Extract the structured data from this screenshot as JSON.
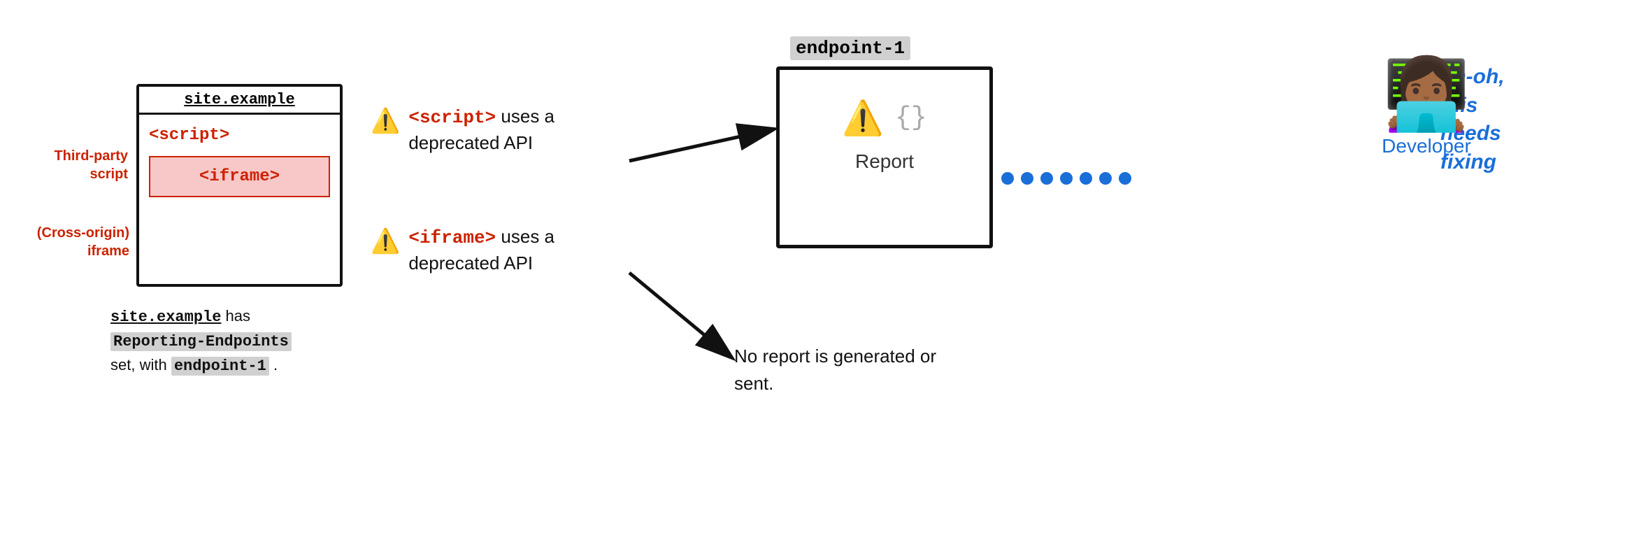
{
  "browser": {
    "title": "site.example",
    "script_label": "<script>",
    "iframe_label": "<iframe>"
  },
  "labels": {
    "third_party": "Third-party\nscript",
    "cross_origin": "(Cross-origin)\niframe"
  },
  "bottom_text": {
    "line1_code": "site.example",
    "line1_rest": " has",
    "line2_code": "Reporting-Endpoints",
    "line3_start": "set, with ",
    "line3_code": "endpoint-1",
    "line3_end": " ."
  },
  "warnings": {
    "script": {
      "icon": "⚠️",
      "text_code": "<script>",
      "text_rest": " uses a deprecated API"
    },
    "iframe": {
      "icon": "⚠️",
      "text_code": "<iframe>",
      "text_rest": " uses a deprecated API"
    }
  },
  "endpoint": {
    "label": "endpoint-1",
    "warning_icon": "⚠️",
    "json_icon": "{}",
    "report_label": "Report"
  },
  "no_report": {
    "text": "No report is generated or sent."
  },
  "developer": {
    "figure": "👩🏾‍💻",
    "label": "Developer"
  },
  "uh_oh": {
    "text": "uh-oh,\nthis\nneeds\nfixing"
  },
  "arrows": {
    "script_to_endpoint": "arrow from warning-script to endpoint-box",
    "iframe_to_noreport": "arrow from warning-iframe to no-report"
  }
}
